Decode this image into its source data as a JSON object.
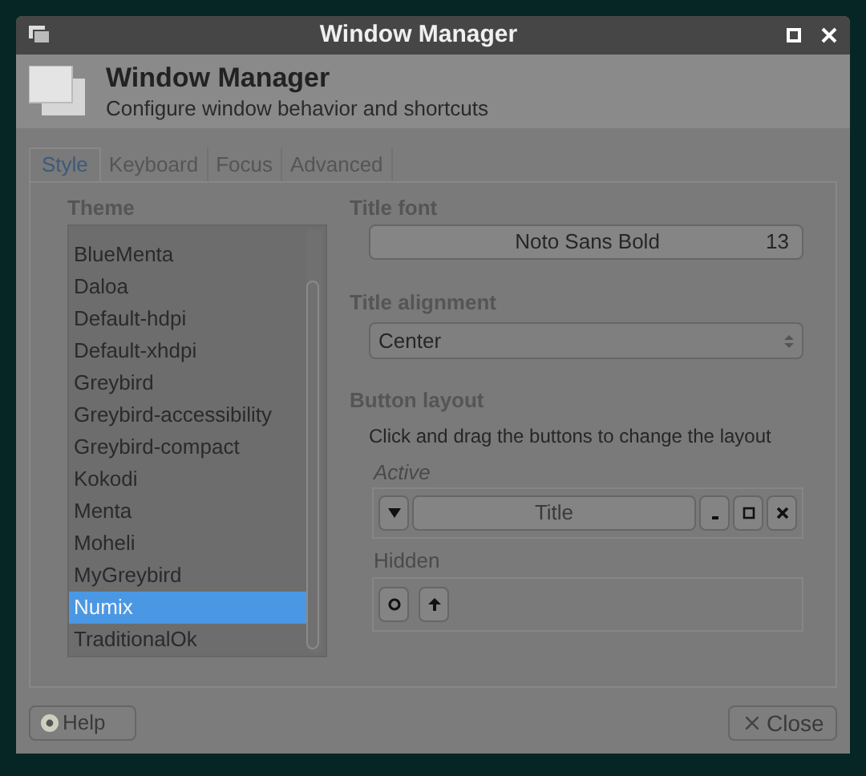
{
  "window": {
    "title": "Window Manager"
  },
  "header": {
    "title": "Window Manager",
    "subtitle": "Configure window behavior and shortcuts"
  },
  "tabs": [
    {
      "label": "Style",
      "selected": true
    },
    {
      "label": "Keyboard",
      "selected": false
    },
    {
      "label": "Focus",
      "selected": false
    },
    {
      "label": "Advanced",
      "selected": false
    }
  ],
  "theme": {
    "label": "Theme",
    "items": [
      {
        "label": "BlueMenta",
        "selected": false
      },
      {
        "label": "Daloa",
        "selected": false
      },
      {
        "label": "Default-hdpi",
        "selected": false
      },
      {
        "label": "Default-xhdpi",
        "selected": false
      },
      {
        "label": "Greybird",
        "selected": false
      },
      {
        "label": "Greybird-accessibility",
        "selected": false
      },
      {
        "label": "Greybird-compact",
        "selected": false
      },
      {
        "label": "Kokodi",
        "selected": false
      },
      {
        "label": "Menta",
        "selected": false
      },
      {
        "label": "Moheli",
        "selected": false
      },
      {
        "label": "MyGreybird",
        "selected": false
      },
      {
        "label": "Numix",
        "selected": true
      },
      {
        "label": "TraditionalOk",
        "selected": false
      }
    ]
  },
  "title_font": {
    "label": "Title font",
    "font": "Noto Sans Bold",
    "size": "13"
  },
  "title_alignment": {
    "label": "Title alignment",
    "value": "Center"
  },
  "button_layout": {
    "label": "Button layout",
    "hint": "Click and drag the buttons to change the layout",
    "active": {
      "label": "Active",
      "buttons": [
        {
          "kind": "menu"
        },
        {
          "kind": "title",
          "label": "Title"
        },
        {
          "kind": "minimize"
        },
        {
          "kind": "maximize"
        },
        {
          "kind": "close"
        }
      ]
    },
    "hidden": {
      "label": "Hidden",
      "buttons": [
        {
          "kind": "stick"
        },
        {
          "kind": "shade"
        }
      ]
    }
  },
  "footer": {
    "help": "Help",
    "close": "Close"
  }
}
